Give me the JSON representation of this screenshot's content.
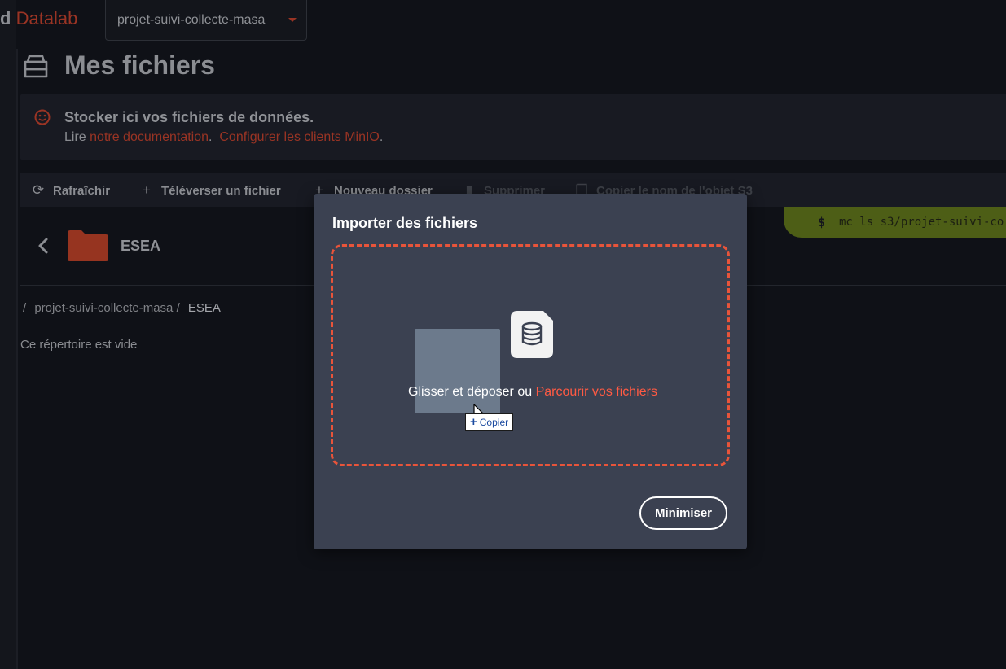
{
  "header": {
    "brand_partial": "d",
    "brand_datalab": "Datalab",
    "project_select_value": "projet-suivi-collecte-masa"
  },
  "page": {
    "title": "Mes fichiers",
    "title_icon": "storage-icon"
  },
  "banner": {
    "icon": "smile-icon",
    "heading": "Stocker ici vos fichiers de données.",
    "read_prefix": "Lire",
    "doc_link": "notre documentation",
    "doc_suffix": ".",
    "minio_link": "Configurer les clients MinIO",
    "minio_suffix": "."
  },
  "toolbar": {
    "refresh": "Rafraîchir",
    "upload": "Téléverser un fichier",
    "new_folder": "Nouveau dossier",
    "delete": "Supprimer",
    "copy_s3": "Copier le nom de l'objet S3"
  },
  "terminal": {
    "prompt": "$",
    "command": "mc ls s3/projet-suivi-co"
  },
  "folder": {
    "name": "ESEA"
  },
  "breadcrumb": {
    "sep": "/",
    "project": "projet-suivi-collecte-masa",
    "current": "ESEA"
  },
  "empty_message": "Ce répertoire est vide",
  "modal": {
    "title": "Importer des fichiers",
    "drop_text": "Glisser et déposer ou",
    "browse_link": "Parcourir vos fichiers",
    "copy_tooltip": "Copier",
    "minimize_button": "Minimiser"
  },
  "colors": {
    "accent_red": "#e8543a",
    "link_red": "#ff5a43",
    "terminal_green": "#4d5e16",
    "modal_bg": "#3b4151",
    "page_bg": "#0f1117"
  }
}
